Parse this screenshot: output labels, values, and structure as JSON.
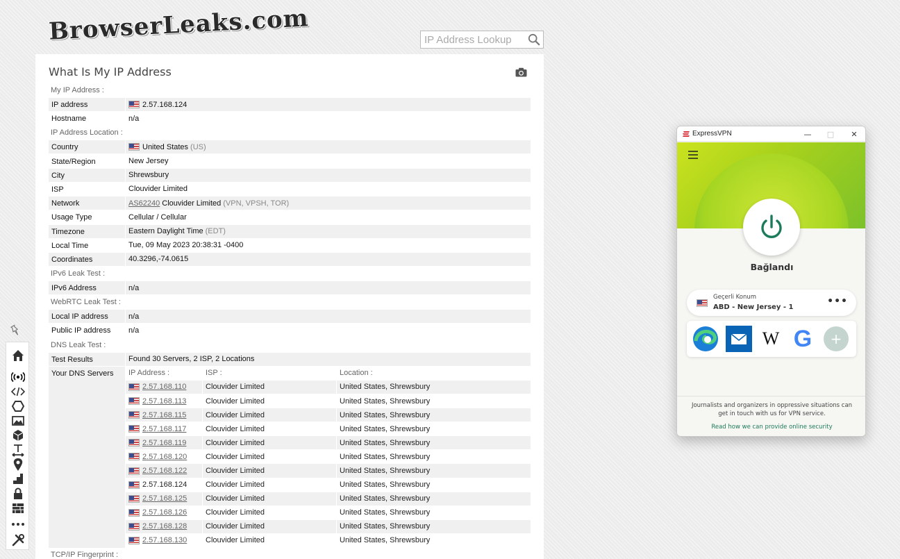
{
  "site": {
    "logo_text": "BrowserLeaks.com",
    "search_placeholder": "IP Address Lookup"
  },
  "page_title": "What Is My IP Address",
  "sections": {
    "my_ip": {
      "title": "My IP Address :",
      "ip_label": "IP address",
      "ip_value": "2.57.168.124",
      "host_label": "Hostname",
      "host_value": "n/a"
    },
    "location": {
      "title": "IP Address Location :",
      "country_label": "Country",
      "country_value": "United States",
      "country_code": "(US)",
      "state_label": "State/Region",
      "state_value": "New Jersey",
      "city_label": "City",
      "city_value": "Shrewsbury",
      "isp_label": "ISP",
      "isp_value": "Clouvider Limited",
      "network_label": "Network",
      "network_as": "AS62240",
      "network_name": "Clouvider Limited",
      "network_tags": "(VPN, VPSH, TOR)",
      "usage_label": "Usage Type",
      "usage_value": "Cellular / Cellular",
      "tz_label": "Timezone",
      "tz_value": "Eastern Daylight Time",
      "tz_abbr": "(EDT)",
      "localtime_label": "Local Time",
      "localtime_value": "Tue, 09 May 2023 20:38:31 -0400",
      "coords_label": "Coordinates",
      "coords_value": "40.3296,-74.0615"
    },
    "ipv6": {
      "title": "IPv6 Leak Test :",
      "addr_label": "IPv6 Address",
      "addr_value": "n/a"
    },
    "webrtc": {
      "title": "WebRTC Leak Test :",
      "local_label": "Local IP address",
      "local_value": "n/a",
      "public_label": "Public IP address",
      "public_value": "n/a"
    },
    "dns": {
      "title": "DNS Leak Test :",
      "results_label": "Test Results",
      "results_value": "Found 30 Servers, 2 ISP, 2 Locations",
      "servers_label": "Your DNS Servers",
      "col_ip": "IP Address :",
      "col_isp": "ISP :",
      "col_loc": "Location :",
      "rows": [
        {
          "ip": "2.57.168.110",
          "isp": "Clouvider Limited",
          "loc": "United States, Shrewsbury"
        },
        {
          "ip": "2.57.168.113",
          "isp": "Clouvider Limited",
          "loc": "United States, Shrewsbury"
        },
        {
          "ip": "2.57.168.115",
          "isp": "Clouvider Limited",
          "loc": "United States, Shrewsbury"
        },
        {
          "ip": "2.57.168.117",
          "isp": "Clouvider Limited",
          "loc": "United States, Shrewsbury"
        },
        {
          "ip": "2.57.168.119",
          "isp": "Clouvider Limited",
          "loc": "United States, Shrewsbury"
        },
        {
          "ip": "2.57.168.120",
          "isp": "Clouvider Limited",
          "loc": "United States, Shrewsbury"
        },
        {
          "ip": "2.57.168.122",
          "isp": "Clouvider Limited",
          "loc": "United States, Shrewsbury"
        },
        {
          "ip": "2.57.168.124",
          "isp": "Clouvider Limited",
          "loc": "United States, Shrewsbury"
        },
        {
          "ip": "2.57.168.125",
          "isp": "Clouvider Limited",
          "loc": "United States, Shrewsbury"
        },
        {
          "ip": "2.57.168.126",
          "isp": "Clouvider Limited",
          "loc": "United States, Shrewsbury"
        },
        {
          "ip": "2.57.168.128",
          "isp": "Clouvider Limited",
          "loc": "United States, Shrewsbury"
        },
        {
          "ip": "2.57.168.130",
          "isp": "Clouvider Limited",
          "loc": "United States, Shrewsbury"
        }
      ]
    },
    "tcpip": {
      "title": "TCP/IP Fingerprint :"
    }
  },
  "sidebar_icons": [
    "pin-icon",
    "home-icon",
    "broadcast-icon",
    "code-icon",
    "puzzle-icon",
    "image-icon",
    "cube-icon",
    "text-icon",
    "location-icon",
    "chart-icon",
    "lock-icon",
    "firewall-icon",
    "more-icon",
    "tools-icon"
  ],
  "vpn": {
    "title": "ExpressVPN",
    "status": "Bağlandı",
    "location_label": "Geçerli Konum",
    "location_name": "ABD - New Jersey - 1",
    "more": "•••",
    "apps": [
      "edge-icon",
      "mail-icon",
      "wikipedia-icon",
      "google-icon",
      "add-shortcut-icon"
    ],
    "wiki_glyph": "W",
    "google_glyph": "G",
    "add_glyph": "+",
    "footer_text": "Journalists and organizers in oppressive situations can get in touch with us for VPN service.",
    "footer_link": "Read how we can provide online security",
    "accent_color": "#1c7b5a",
    "hero_color": "#b5d81f"
  },
  "colors": {
    "row_bg": "#f0f0f0",
    "link": "#666666",
    "flag_red": "#c9403e",
    "flag_blue": "#3a4d8f"
  }
}
